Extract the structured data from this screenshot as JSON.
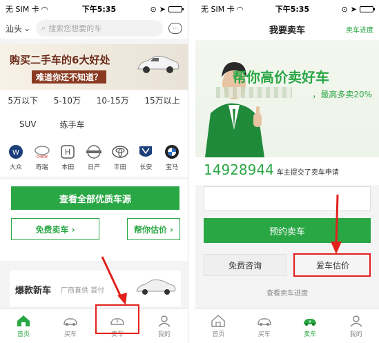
{
  "left_screen": {
    "status": {
      "carrier": "无 SIM 卡",
      "time": "下午5:35"
    },
    "search": {
      "city": "汕头",
      "placeholder": "搜索您想要的车"
    },
    "banner": {
      "headline": "购买二手车的6大好处",
      "subline": "难道你还不知道？"
    },
    "price_filters": [
      "5万以下",
      "5-10万",
      "10-15万",
      "15万以上"
    ],
    "type_filters": [
      "SUV",
      "练手车"
    ],
    "brands": [
      {
        "name": "大众",
        "icon": "volkswagen-logo"
      },
      {
        "name": "奇瑞",
        "icon": "chery-logo"
      },
      {
        "name": "本田",
        "icon": "honda-logo"
      },
      {
        "name": "日产",
        "icon": "nissan-logo"
      },
      {
        "name": "丰田",
        "icon": "toyota-logo"
      },
      {
        "name": "长安",
        "icon": "changan-logo"
      },
      {
        "name": "宝马",
        "icon": "bmw-logo"
      }
    ],
    "buttons": {
      "view_all": "查看全部优质车源",
      "free_sell": "免费卖车 ›",
      "help_estimate": "帮你估价 ›"
    },
    "hot_car": {
      "title": "爆款新车",
      "subtitle": "厂商直供 首付"
    },
    "tabs": [
      {
        "label": "首页",
        "icon": "home-icon",
        "active": true
      },
      {
        "label": "买车",
        "icon": "car-icon",
        "active": false
      },
      {
        "label": "卖车",
        "icon": "sell-car-icon",
        "active": false
      },
      {
        "label": "我的",
        "icon": "person-icon",
        "active": false
      }
    ]
  },
  "right_screen": {
    "status": {
      "carrier": "无 SIM 卡",
      "time": "下午5:35"
    },
    "nav": {
      "title": "我要卖车",
      "progress_link": "卖车进度"
    },
    "banner": {
      "headline": "帮你高价卖好车",
      "subline": "，最高多卖20%"
    },
    "apply": {
      "count": "14928944",
      "text": "车主提交了卖车申请"
    },
    "buttons": {
      "reserve": "预约卖车",
      "consult": "免费咨询",
      "estimate": "爱车估价"
    },
    "progress_text": "查看卖车进度",
    "tabs": [
      {
        "label": "首页",
        "icon": "home-icon",
        "active": false
      },
      {
        "label": "买车",
        "icon": "car-icon",
        "active": false
      },
      {
        "label": "卖车",
        "icon": "sell-car-icon",
        "active": true
      },
      {
        "label": "我的",
        "icon": "person-icon",
        "active": false
      }
    ]
  },
  "colors": {
    "brand_green": "#2aa745",
    "highlight_red": "#e3201b"
  }
}
